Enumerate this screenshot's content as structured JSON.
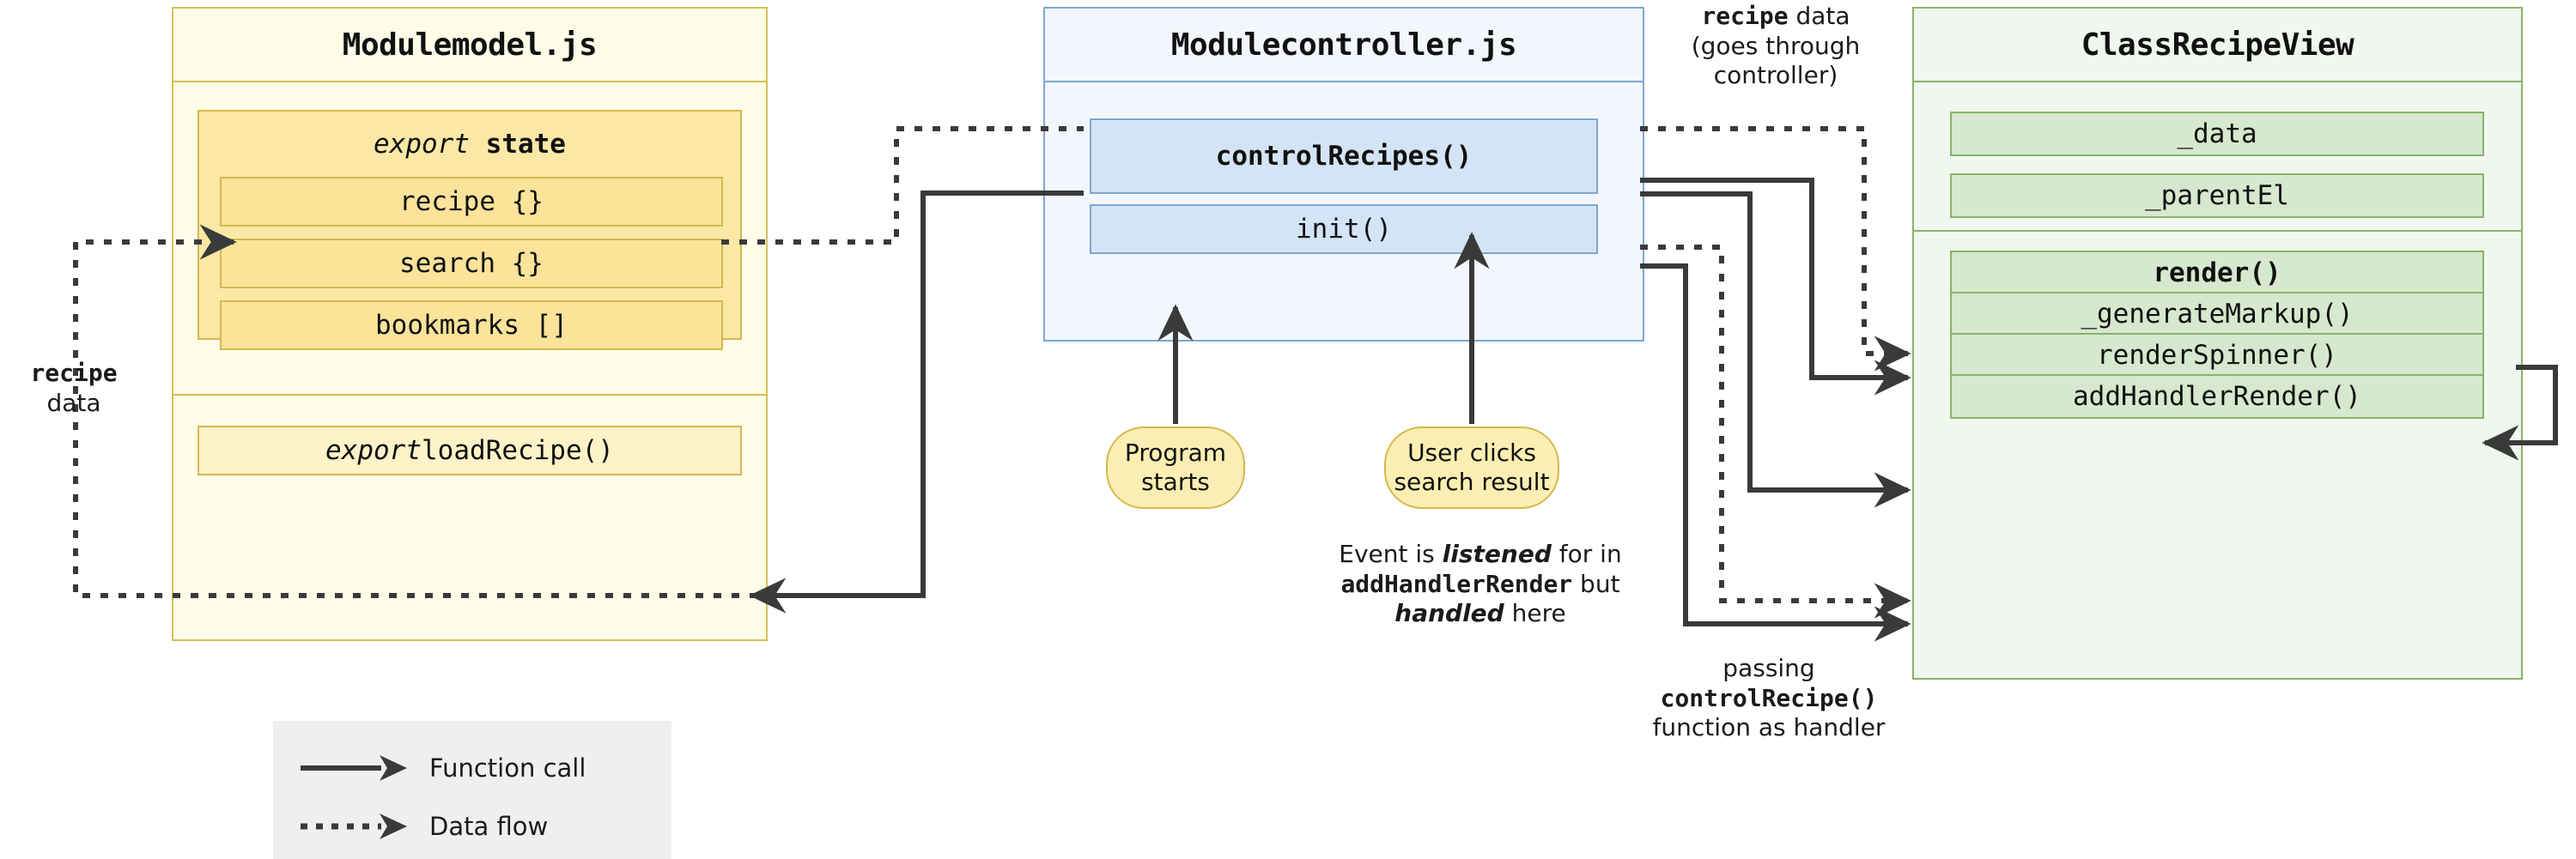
{
  "diagram": {
    "title": "MVC architecture flow",
    "colors": {
      "model_fill": "#fefde8",
      "model_border": "#d6bf57",
      "model_item_fill": "#fbe39a",
      "controller_fill": "#f3f7fd",
      "controller_border": "#7da7d0",
      "controller_item_fill": "#d4e4f7",
      "view_fill": "#f0f7ee",
      "view_border": "#88b46a",
      "view_item_fill": "#d6e8cd",
      "bubble_fill": "#fbeeb2",
      "arrow": "#3a3a3a",
      "legend_fill": "#efefef"
    }
  },
  "model": {
    "title_prefix": "Module ",
    "title_name": "model.js",
    "state_group": {
      "keyword": "export ",
      "name": "state",
      "items": [
        {
          "label": "recipe {}"
        },
        {
          "label": "search {}"
        },
        {
          "label": "bookmarks []"
        }
      ]
    },
    "functions": [
      {
        "keyword": "export ",
        "name": "loadRecipe()"
      }
    ]
  },
  "controller": {
    "title_prefix": "Module ",
    "title_name": "controller.js",
    "items": [
      {
        "label": "controlRecipes()",
        "bold": true
      },
      {
        "label": "init()",
        "bold": false
      }
    ]
  },
  "view": {
    "title_prefix": "Class ",
    "title_name": "RecipeView",
    "properties": [
      {
        "label": "_data"
      },
      {
        "label": "_parentEl"
      }
    ],
    "methods": [
      {
        "label": "render()",
        "bold": true
      },
      {
        "label": "_generateMarkup()",
        "bold": false
      },
      {
        "label": "renderSpinner()",
        "bold": false
      },
      {
        "label": "addHandlerRender()",
        "bold": false
      }
    ]
  },
  "events": [
    {
      "lines": [
        "Program",
        "starts"
      ]
    },
    {
      "lines": [
        "User clicks",
        "search result"
      ]
    }
  ],
  "annotations": {
    "recipe_data_left": {
      "line1": "recipe",
      "line2": "data"
    },
    "recipe_data_top": {
      "mono": "recipe",
      "rest": " data",
      "line2": "(goes through",
      "line3": "controller)"
    },
    "event_listened": {
      "l1_a": "Event is ",
      "l1_b": "listened",
      "l1_c": " for in",
      "l2_a": "addHandlerRender",
      "l2_b": " but",
      "l3_a": "handled",
      "l3_b": " here"
    },
    "passing_handler": {
      "line1": "passing",
      "line2": "controlRecipe()",
      "line3": "function as handler"
    }
  },
  "legend": {
    "items": [
      {
        "label": "Function call",
        "style": "solid"
      },
      {
        "label": "Data flow",
        "style": "dotted"
      }
    ]
  }
}
